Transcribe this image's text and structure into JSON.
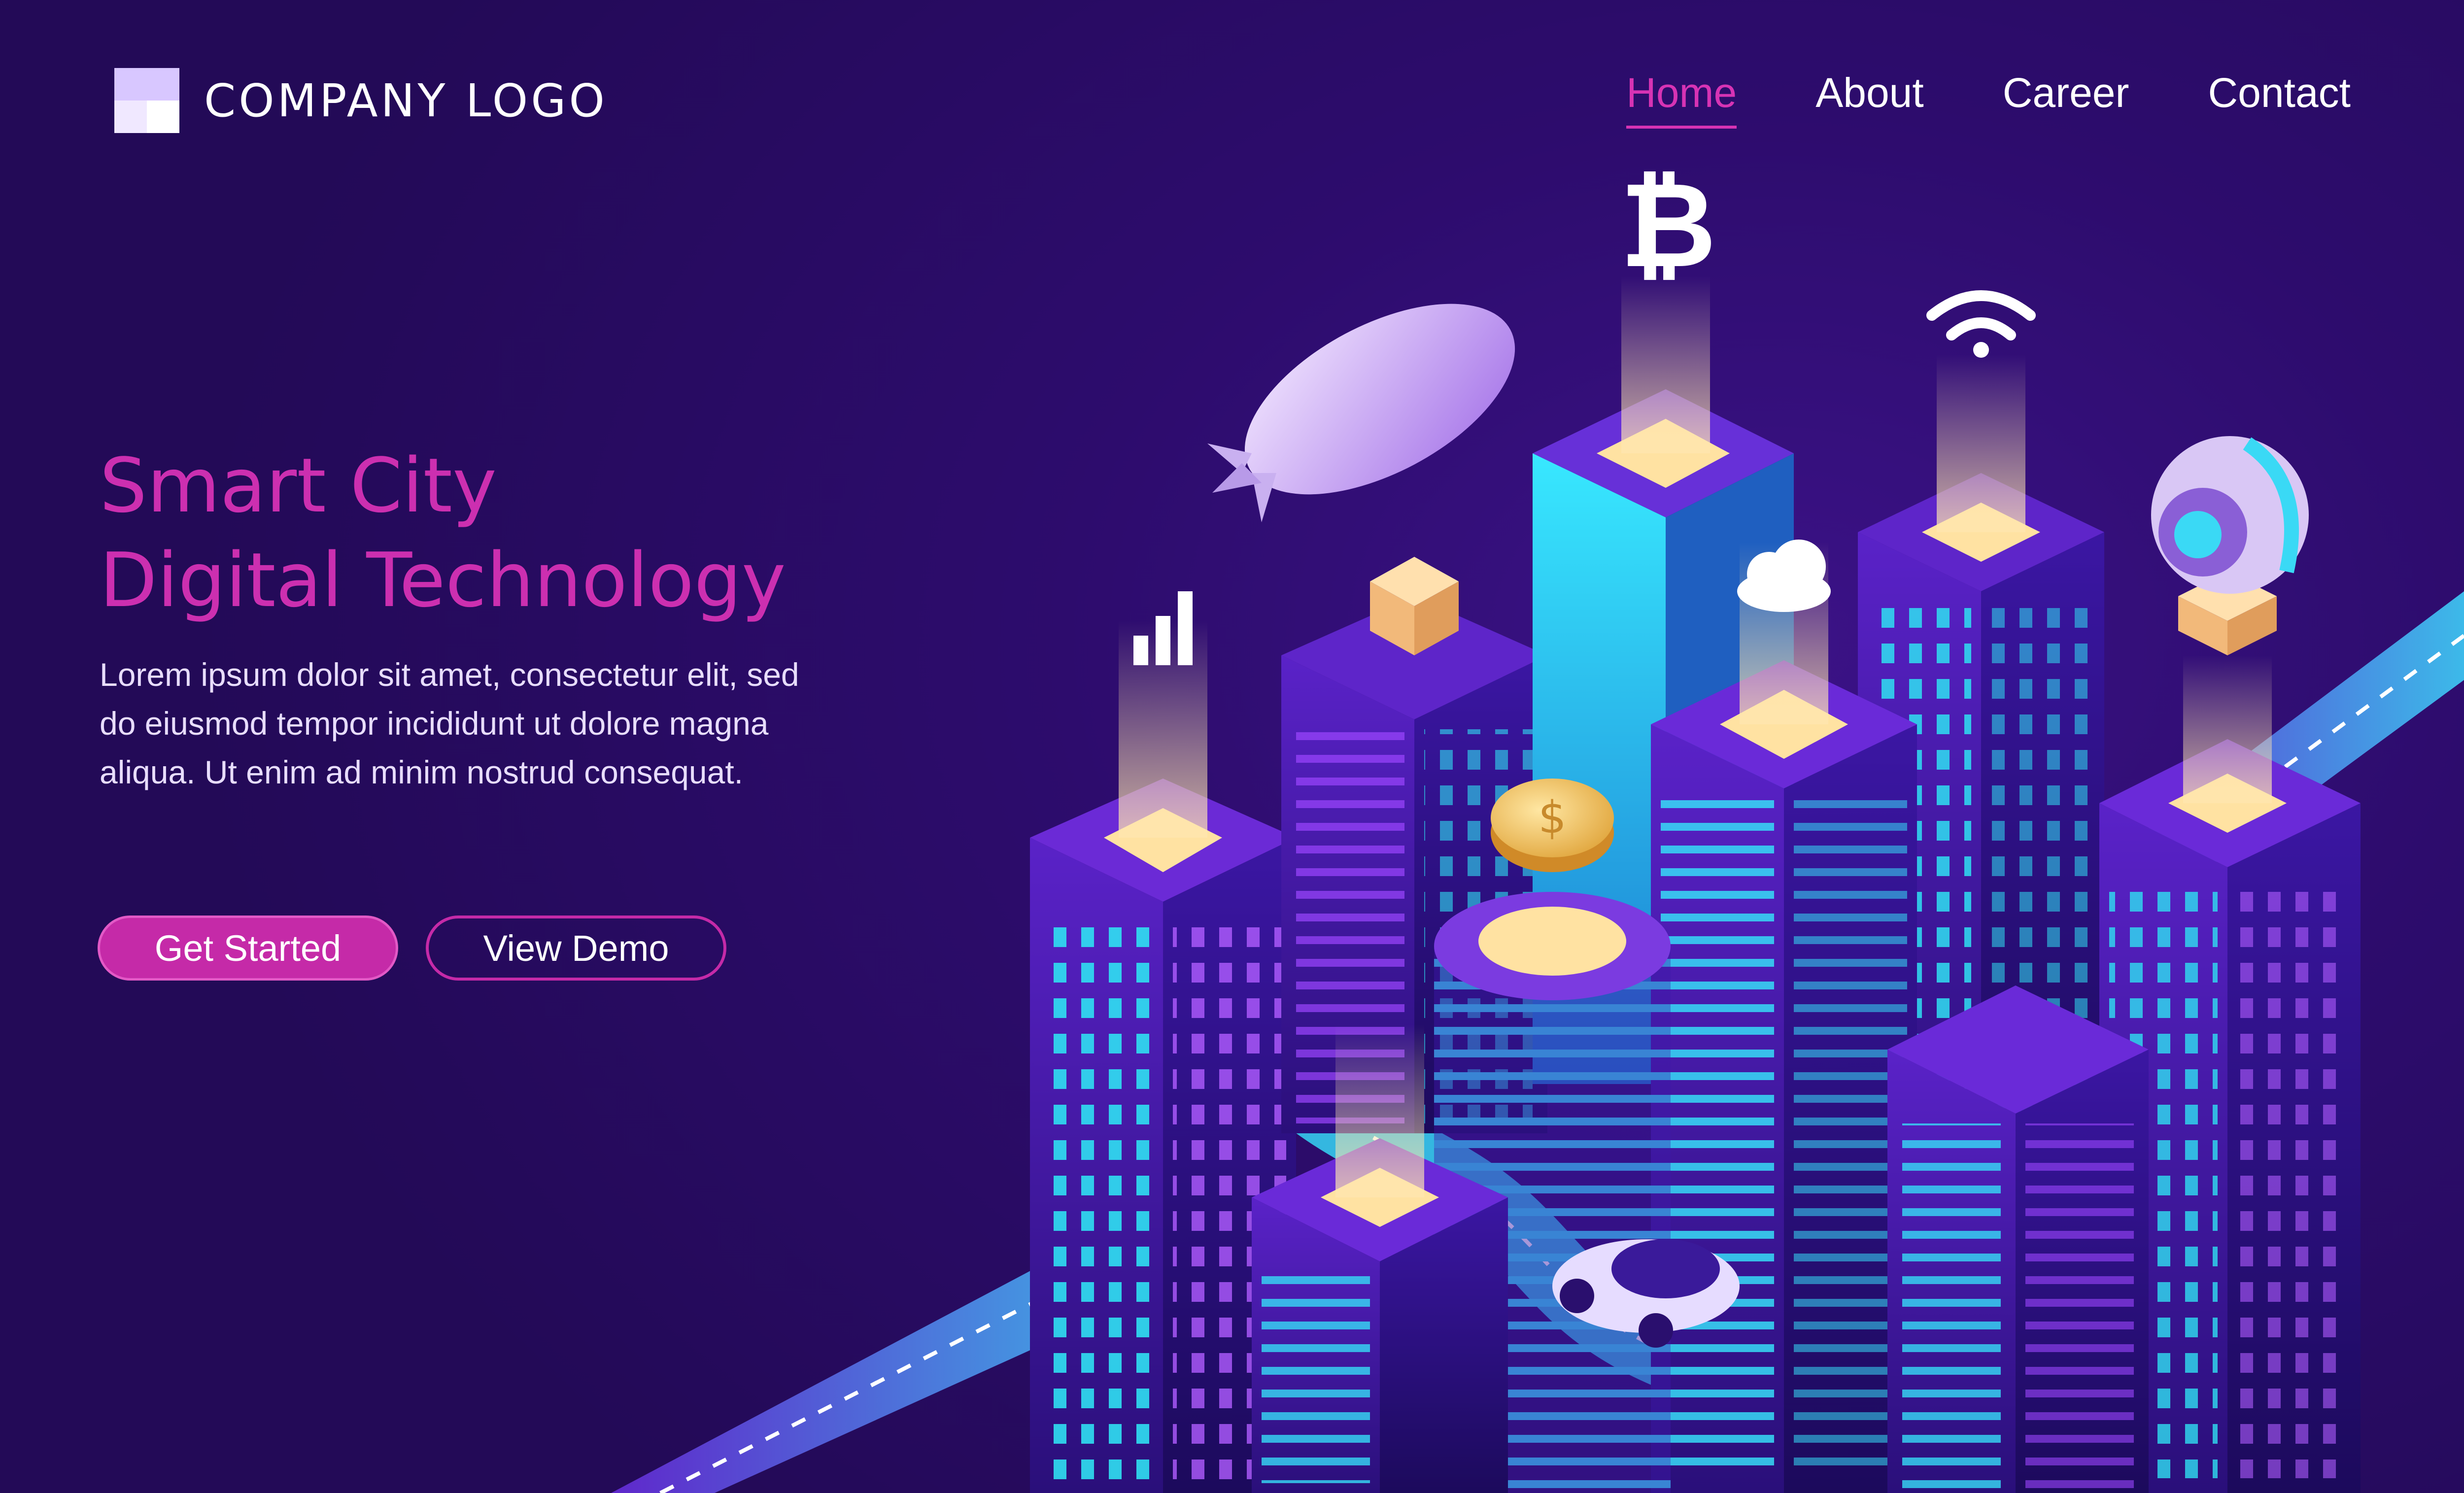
{
  "header": {
    "logo_text": "COMPANY LOGO",
    "nav": [
      {
        "label": "Home",
        "active": true
      },
      {
        "label": "About",
        "active": false
      },
      {
        "label": "Career",
        "active": false
      },
      {
        "label": "Contact",
        "active": false
      }
    ]
  },
  "hero": {
    "title_line1": "Smart City",
    "title_line2": "Digital Technology",
    "description": "Lorem ipsum dolor sit amet, consectetur elit, sed do eiusmod tempor incididunt ut dolore magna aliqua. Ut enim ad minim nostrud consequat.",
    "primary_button": "Get Started",
    "secondary_button": "View Demo"
  },
  "illustration": {
    "icons": [
      "bitcoin-icon",
      "wifi-icon",
      "signal-bars-icon",
      "cloud-icon",
      "coin-icon",
      "parcel-icon",
      "camera-drone-icon",
      "airship-icon",
      "car-icon"
    ]
  },
  "colors": {
    "accent": "#cc2fb0",
    "background": "#2d0c6d",
    "building_glow": "#29e4f4",
    "building_purple": "#7a2fe0",
    "light": "#ffd98a"
  }
}
